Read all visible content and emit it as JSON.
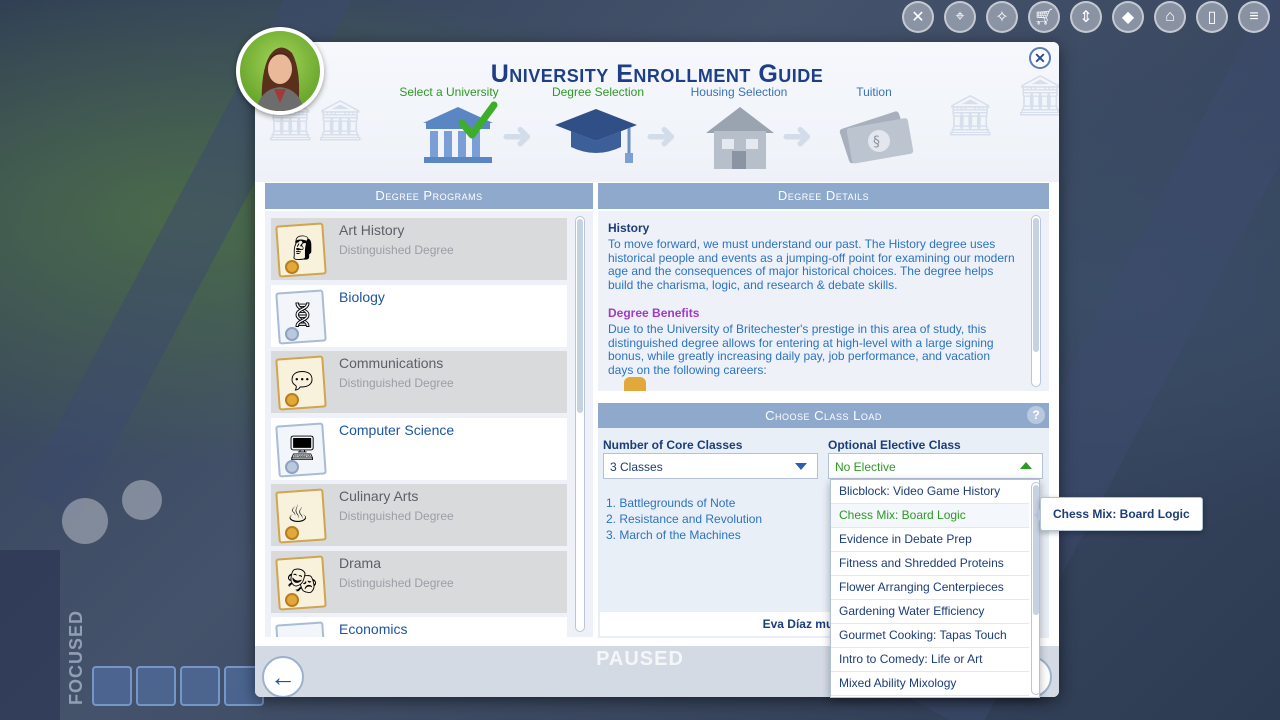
{
  "dialog": {
    "title": "University Enrollment Guide",
    "close_label": "✕"
  },
  "steps": [
    {
      "label": "Select a University",
      "status": "done",
      "icon": "university-icon"
    },
    {
      "label": "Degree Selection",
      "status": "active",
      "icon": "graduation-cap-icon"
    },
    {
      "label": "Housing Selection",
      "status": "todo",
      "icon": "house-icon"
    },
    {
      "label": "Tuition",
      "status": "todo",
      "icon": "money-icon"
    }
  ],
  "programs": {
    "header": "Degree Programs",
    "items": [
      {
        "name": "Art History",
        "sub": "Distinguished Degree",
        "icon": "thinker-statue-icon",
        "distinguished": true
      },
      {
        "name": "Biology",
        "sub": "",
        "icon": "dna-icon",
        "distinguished": false
      },
      {
        "name": "Communications",
        "sub": "Distinguished Degree",
        "icon": "speech-bubbles-icon",
        "distinguished": true
      },
      {
        "name": "Computer Science",
        "sub": "",
        "icon": "computer-icon",
        "distinguished": false
      },
      {
        "name": "Culinary Arts",
        "sub": "Distinguished Degree",
        "icon": "chef-hat-icon",
        "distinguished": true
      },
      {
        "name": "Drama",
        "sub": "Distinguished Degree",
        "icon": "theater-masks-icon",
        "distinguished": true
      },
      {
        "name": "Economics",
        "sub": "",
        "icon": "chart-icon",
        "distinguished": false
      }
    ]
  },
  "details": {
    "header": "Degree Details",
    "heading": "History",
    "description": "To move forward, we must understand our past. The History degree uses historical people and events as a jumping-off point for examining our modern age and the consequences of major historical choices. The degree helps build the charisma, logic, and research & debate skills.",
    "benefits_heading": "Degree Benefits",
    "benefits_text": "Due to the University of Britechester's prestige in this area of study, this distinguished degree allows for entering at high-level with a large signing bonus, while greatly increasing daily pay, job performance, and vacation days on the following careers:"
  },
  "classload": {
    "header": "Choose Class Load",
    "help_label": "?",
    "core_label": "Number of Core Classes",
    "core_value": "3 Classes",
    "elective_label": "Optional Elective Class",
    "elective_value": "No Elective",
    "core_classes": [
      "1.  Battlegrounds of Note",
      "2.  Resistance and Revolution",
      "3.  March of the Machines"
    ],
    "must_complete": "Eva Díaz must complete"
  },
  "elective_options": [
    "Blicblock: Video Game History",
    "Chess Mix: Board Logic",
    "Evidence in Debate Prep",
    "Fitness and Shredded Proteins",
    "Flower Arranging Centerpieces",
    "Gardening Water Efficiency",
    "Gourmet Cooking: Tapas Touch",
    "Intro to Comedy: Life or Art",
    "Mixed Ability Mixology"
  ],
  "highlighted_option": "Chess Mix: Board Logic",
  "tooltip": "Chess Mix: Board Logic",
  "footer": {
    "paused": "PAUSED",
    "back_label": "←",
    "next_label": "›"
  },
  "hud": {
    "focused": "FOCUSED"
  },
  "colors": {
    "title": "#1e3f86",
    "accent_green": "#2c9a24",
    "link_blue": "#2c73c2",
    "panel_header": "#8fa9cc",
    "benefits_purple": "#a23bc3"
  }
}
